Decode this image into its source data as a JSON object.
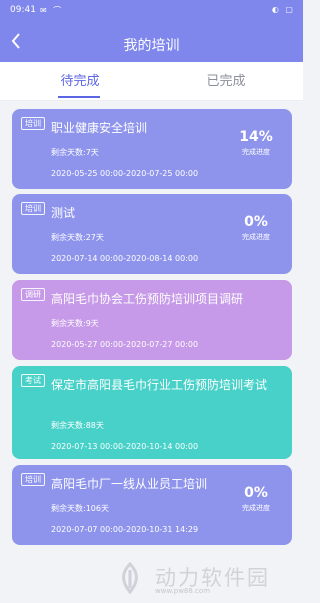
{
  "status_bar": {
    "time": "09:41",
    "left_icons": "✉ ⌒",
    "right_icons": "◐ ▢"
  },
  "header": {
    "back_icon": "chevron-left-icon",
    "title": "我的培训"
  },
  "tabs": [
    {
      "label": "待完成",
      "active": true
    },
    {
      "label": "已完成",
      "active": false
    }
  ],
  "cards": [
    {
      "badge": "培训",
      "title": "职业健康安全培训",
      "remaining": "剩余天数:7天",
      "dates": "2020-05-25 00:00-2020-07-25 00:00",
      "percent": "14%",
      "percent_label": "完成进度",
      "color": "#8e94ec"
    },
    {
      "badge": "培训",
      "title": "测试",
      "remaining": "剩余天数:27天",
      "dates": "2020-07-14 00:00-2020-08-14 00:00",
      "percent": "0%",
      "percent_label": "完成进度",
      "color": "#8e94ec"
    },
    {
      "badge": "调研",
      "title": "高阳毛巾协会工伤预防培训项目调研",
      "remaining": "剩余天数:9天",
      "dates": "2020-05-27 00:00-2020-07-27 00:00",
      "color": "#c69ae8"
    },
    {
      "badge": "考试",
      "title": "保定市高阳县毛巾行业工伤预防培训考试",
      "remaining": "剩余天数:88天",
      "dates": "2020-07-13 00:00-2020-10-14 00:00",
      "color": "#48d1c8"
    },
    {
      "badge": "培训",
      "title": "高阳毛巾厂一线从业员工培训",
      "remaining": "剩余天数:106天",
      "dates": "2020-07-07 00:00-2020-10-31 14:29",
      "percent": "0%",
      "percent_label": "完成进度",
      "color": "#8e94ec"
    }
  ],
  "watermark": {
    "main": "动力软件园",
    "sub": "www.pw88.com"
  }
}
